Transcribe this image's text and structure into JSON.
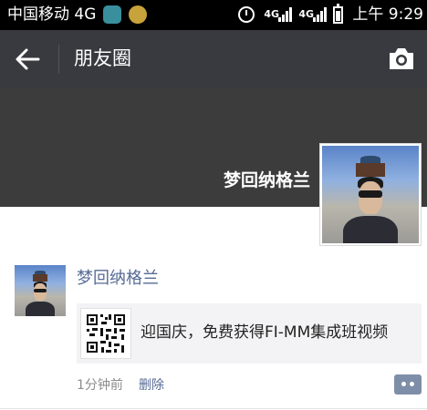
{
  "status_bar": {
    "carrier": "中国移动 4G",
    "network_label_top": "4G",
    "network_label_bottom": "4G",
    "network_label_g": "G",
    "time": "上午 9:29"
  },
  "app_bar": {
    "title": "朋友圈",
    "back_icon": "back-arrow-icon",
    "camera_icon": "camera-icon"
  },
  "cover": {
    "user_name": "梦回纳格兰"
  },
  "post": {
    "author": "梦回纳格兰",
    "share_text": "迎国庆，免费获得FI-MM集成班视频",
    "time": "1分钟前",
    "delete_label": "删除"
  },
  "colors": {
    "app_bar": "#393a3f",
    "link": "#576b95",
    "card_bg": "#f3f3f5"
  }
}
